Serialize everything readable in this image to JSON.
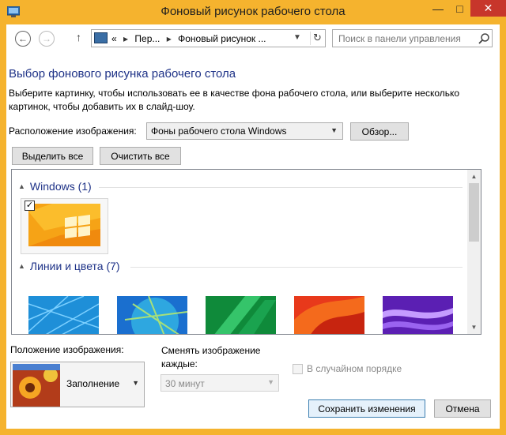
{
  "window": {
    "title": "Фоновый рисунок рабочего стола",
    "title_bar_color": "#f5b32e",
    "controls": {
      "minimize_icon": "minimize-icon",
      "maximize_icon": "maximize-icon",
      "close_icon": "close-icon"
    }
  },
  "nav": {
    "back_icon": "back-arrow-icon",
    "forward_icon": "forward-arrow-icon",
    "up_icon": "up-arrow-icon",
    "address": {
      "prefix": "«",
      "crumbs": [
        "Пер...",
        "Фоновый рисунок ..."
      ]
    },
    "refresh_icon": "refresh-icon",
    "search_placeholder": "Поиск в панели управления"
  },
  "page": {
    "heading": "Выбор фонового рисунка рабочего стола",
    "description": "Выберите картинку, чтобы использовать ее в качестве фона рабочего стола, или выберите несколько картинок, чтобы добавить их в слайд-шоу.",
    "location_label": "Расположение изображения:",
    "location_value": "Фоны рабочего стола Windows",
    "browse_label": "Обзор...",
    "select_all_label": "Выделить все",
    "clear_all_label": "Очистить все"
  },
  "gallery": {
    "groups": [
      {
        "title": "Windows (1)",
        "items": [
          {
            "name": "windows-8-orange",
            "checked": true
          }
        ]
      },
      {
        "title": "Линии и цвета (7)",
        "items": [
          {
            "name": "blue-lines"
          },
          {
            "name": "blue-balloon"
          },
          {
            "name": "green-ribbon"
          },
          {
            "name": "red-abstract"
          },
          {
            "name": "purple-waves"
          }
        ]
      }
    ]
  },
  "options": {
    "position_label": "Положение изображения:",
    "position_value": "Заполнение",
    "interval_label": "Сменять изображение каждые:",
    "interval_value": "30 минут",
    "shuffle_label": "В случайном порядке",
    "shuffle_checked": false
  },
  "footer": {
    "save_label": "Сохранить изменения",
    "cancel_label": "Отмена"
  }
}
